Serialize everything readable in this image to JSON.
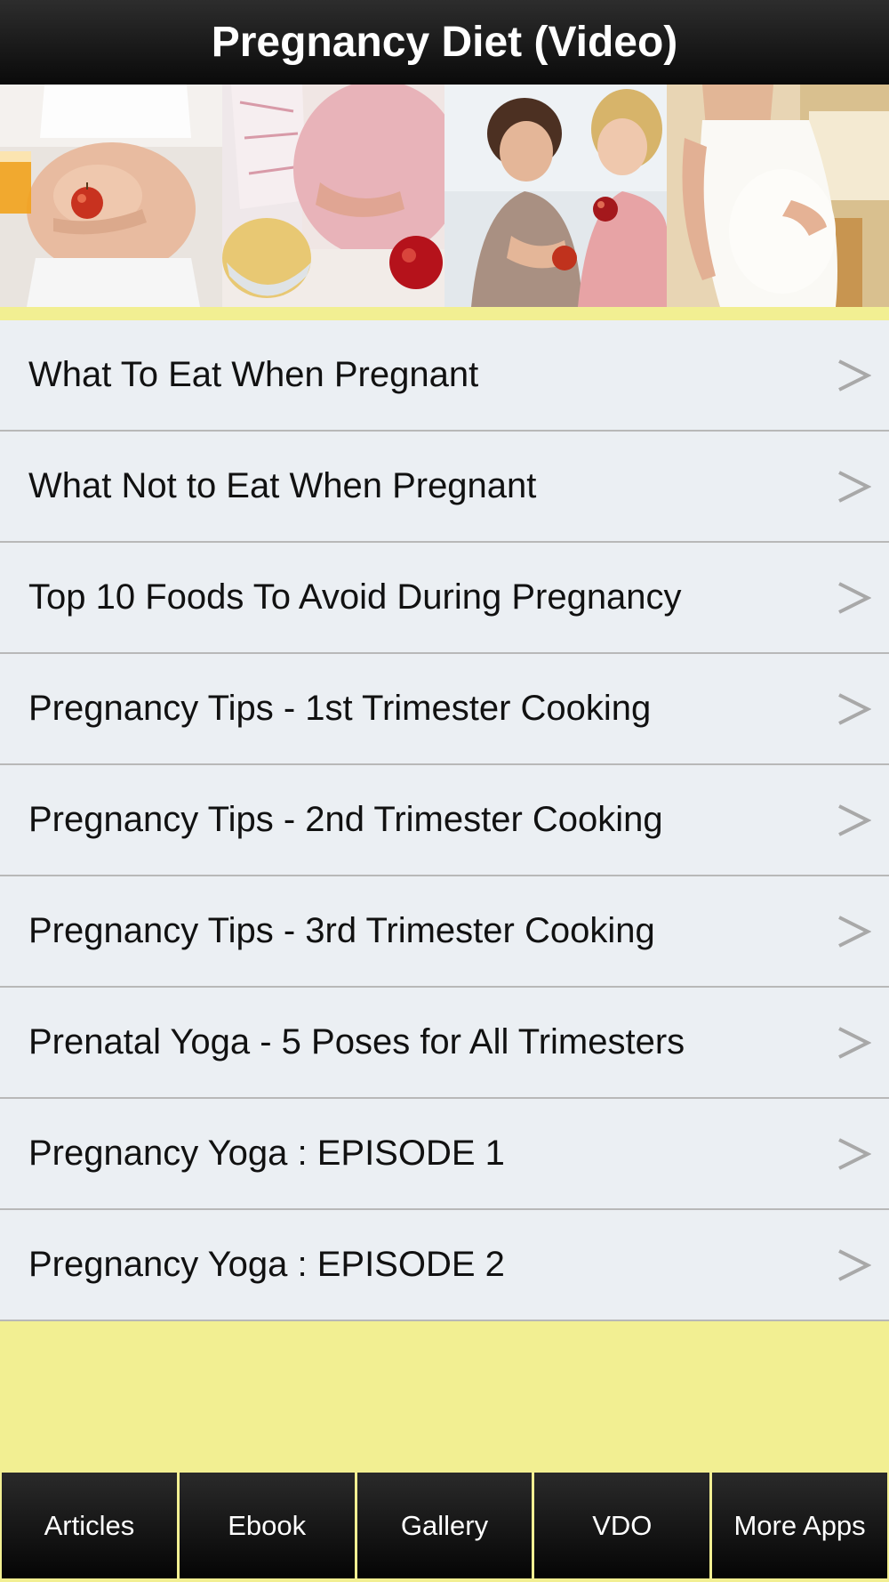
{
  "header": {
    "title": "Pregnancy Diet (Video)"
  },
  "banner": {
    "photos": [
      {
        "name": "pregnant-belly-apple-photo"
      },
      {
        "name": "chips-and-apple-photo"
      },
      {
        "name": "two-women-apples-photo"
      },
      {
        "name": "pregnant-woman-white-top-photo"
      }
    ]
  },
  "menu": {
    "items": [
      {
        "label": "What To Eat When Pregnant"
      },
      {
        "label": "What Not to Eat When Pregnant"
      },
      {
        "label": "Top 10 Foods To Avoid During Pregnancy"
      },
      {
        "label": "Pregnancy Tips - 1st Trimester Cooking"
      },
      {
        "label": "Pregnancy Tips - 2nd Trimester Cooking"
      },
      {
        "label": "Pregnancy Tips - 3rd Trimester Cooking"
      },
      {
        "label": "Prenatal Yoga - 5 Poses for All Trimesters"
      },
      {
        "label": "Pregnancy Yoga : EPISODE 1"
      },
      {
        "label": "Pregnancy Yoga : EPISODE 2"
      }
    ],
    "chevron_icon": "chevron-right-icon"
  },
  "tabbar": {
    "tabs": [
      {
        "label": "Articles"
      },
      {
        "label": "Ebook"
      },
      {
        "label": "Gallery"
      },
      {
        "label": "VDO"
      },
      {
        "label": "More Apps"
      }
    ]
  },
  "colors": {
    "background": "#f2ef92",
    "titlebar": "#1a1a1a",
    "row_background": "#ebeff3",
    "chevron": "#a8a8a8"
  }
}
